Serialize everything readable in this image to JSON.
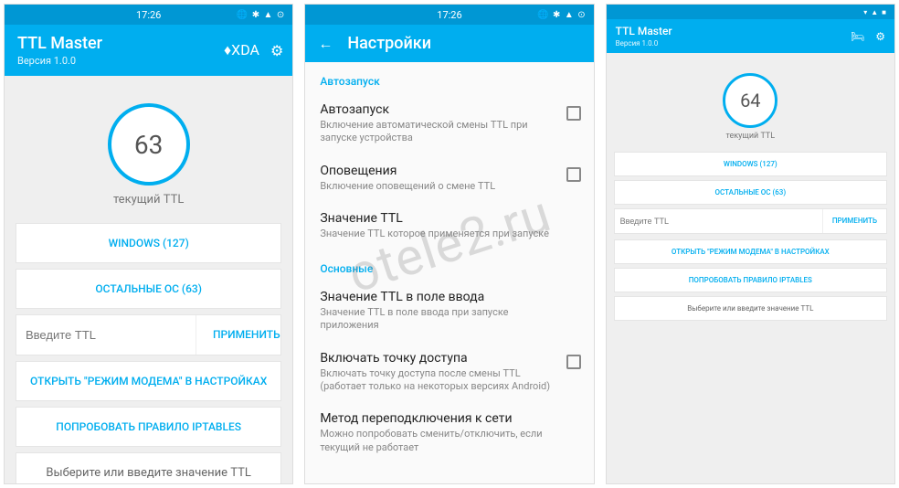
{
  "watermark": "otele2.ru",
  "statusbar": {
    "time": "17:26",
    "icons": "🌐 ✱ ▲ ⊙"
  },
  "screen1": {
    "title": "TTL Master",
    "version": "Версия 1.0.0",
    "xda": "♦XDA",
    "ttl_value": "63",
    "ttl_label": "текущий TTL",
    "btn_windows": "WINDOWS (127)",
    "btn_other": "ОСТАЛЬНЫЕ ОС (63)",
    "input_placeholder": "Введите TTL",
    "btn_apply": "ПРИМЕНИТЬ",
    "btn_tether": "ОТКРЫТЬ \"РЕЖИМ МОДЕМА\" В НАСТРОЙКАХ",
    "btn_iptables": "ПОПРОБОВАТЬ ПРАВИЛО IPTABLES",
    "hint": "Выберите или введите значение TTL"
  },
  "screen2": {
    "title": "Настройки",
    "section_autostart": "Автозапуск",
    "item1": {
      "title": "Автозапуск",
      "sub": "Включение автоматической смены TTL при запуске устройства"
    },
    "item2": {
      "title": "Оповещения",
      "sub": "Включение оповещений о смене TTL"
    },
    "item3": {
      "title": "Значение TTL",
      "sub": "Значение TTL которое применяется при запуске"
    },
    "section_main": "Основные",
    "item4": {
      "title": "Значение TTL в поле ввода",
      "sub": "Значение TTL в поле ввода при запуске приложения"
    },
    "item5": {
      "title": "Включать точку доступа",
      "sub": "Включать точку доступа после смены TTL (работает только на некоторых версиях Android)"
    },
    "item6": {
      "title": "Метод переподключения к сети",
      "sub": "Можно попробовать сменить/отключить, если текущий не работает"
    }
  },
  "screen3": {
    "title": "TTL Master",
    "version": "Версия 1.0.0",
    "ttl_value": "64",
    "ttl_label": "текущий TTL",
    "btn_windows": "WINDOWS (127)",
    "btn_other": "ОСТАЛЬНЫЕ ОС (63)",
    "input_placeholder": "Введите TTL",
    "btn_apply": "ПРИМЕНИТЬ",
    "btn_tether": "ОТКРЫТЬ \"РЕЖИМ МОДЕМА\" В НАСТРОЙКАХ",
    "btn_iptables": "ПОПРОБОВАТЬ ПРАВИЛО IPTABLES",
    "hint": "Выберите или введите значение TTL"
  }
}
